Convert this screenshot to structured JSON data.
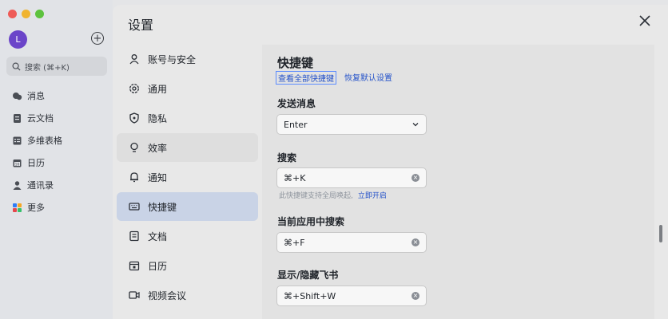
{
  "window": {
    "traffic_colors": [
      "#ee5b57",
      "#f0b430",
      "#5dc23e"
    ]
  },
  "app_sidebar": {
    "avatar_letter": "L",
    "search_placeholder": "搜索 (⌘+K)",
    "items": [
      {
        "label": "消息",
        "icon": "chat-icon"
      },
      {
        "label": "云文档",
        "icon": "document-icon"
      },
      {
        "label": "多维表格",
        "icon": "table-icon"
      },
      {
        "label": "日历",
        "icon": "calendar-icon"
      },
      {
        "label": "通讯录",
        "icon": "contacts-icon"
      },
      {
        "label": "更多",
        "icon": "apps-icon"
      }
    ]
  },
  "dialog": {
    "title": "设置",
    "nav_items": [
      {
        "label": "账号与安全",
        "icon": "user-icon"
      },
      {
        "label": "通用",
        "icon": "gear-icon"
      },
      {
        "label": "隐私",
        "icon": "privacy-icon"
      },
      {
        "label": "效率",
        "icon": "bulb-icon"
      },
      {
        "label": "通知",
        "icon": "bell-icon"
      },
      {
        "label": "快捷键",
        "icon": "keyboard-icon"
      },
      {
        "label": "文档",
        "icon": "doc-icon"
      },
      {
        "label": "日历",
        "icon": "calendar-icon"
      },
      {
        "label": "视频会议",
        "icon": "video-icon"
      }
    ],
    "active_nav": "快捷键",
    "content": {
      "heading": "快捷键",
      "view_all_link": "查看全部快捷键",
      "restore_link": "恢复默认设置",
      "send_message": {
        "label": "发送消息",
        "value": "Enter"
      },
      "search": {
        "label": "搜索",
        "value": "⌘+K",
        "hint": "此快捷键支持全局唤起,",
        "hint_link": "立即开启"
      },
      "current_app_search": {
        "label": "当前应用中搜索",
        "value": "⌘+F"
      },
      "show_hide": {
        "label": "显示/隐藏飞书",
        "value": "⌘+Shift+W"
      }
    }
  }
}
